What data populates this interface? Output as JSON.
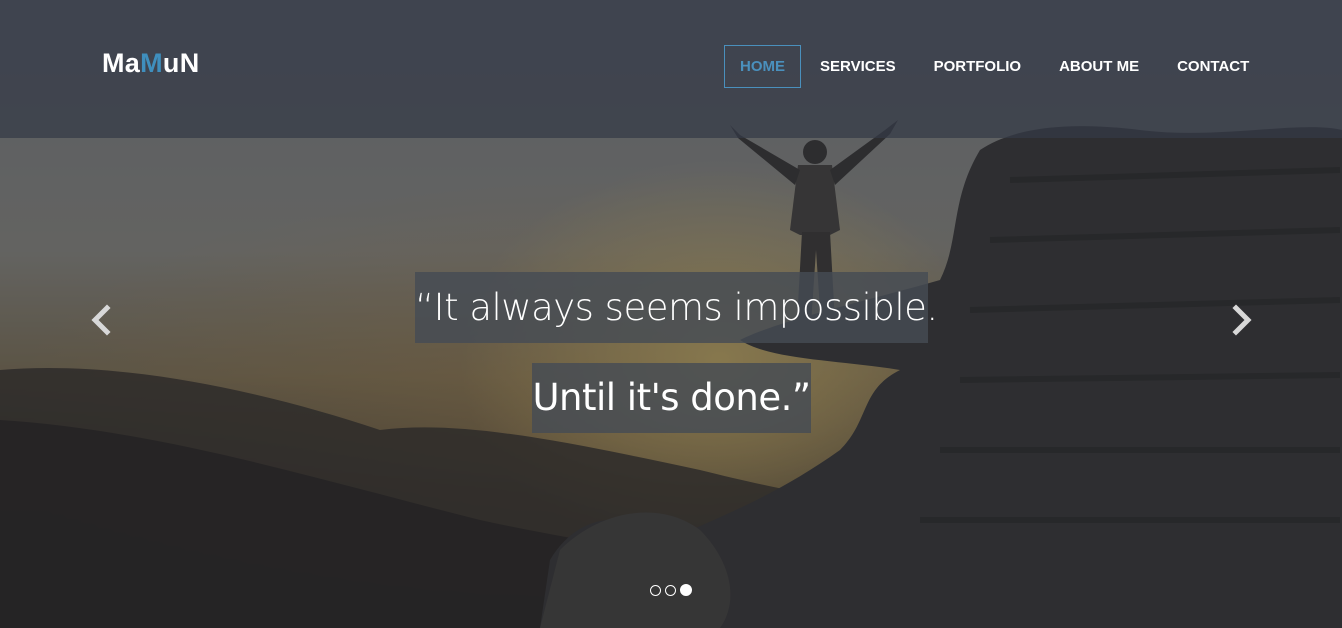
{
  "brand": {
    "part1": "Ma",
    "part2": "M",
    "part3": "uN",
    "accent_color": "#3f8fbe"
  },
  "nav": {
    "items": [
      {
        "label": "HOME",
        "active": true
      },
      {
        "label": "SERVICES",
        "active": false
      },
      {
        "label": "PORTFOLIO",
        "active": false
      },
      {
        "label": "ABOUT ME",
        "active": false
      },
      {
        "label": "CONTACT",
        "active": false
      }
    ]
  },
  "hero": {
    "quote_line1": "“It always seems impossible.",
    "quote_line2": "Until it's done.”",
    "prev_icon": "chevron-left-icon",
    "next_icon": "chevron-right-icon",
    "slides": {
      "count": 3,
      "active_index": 2
    }
  }
}
